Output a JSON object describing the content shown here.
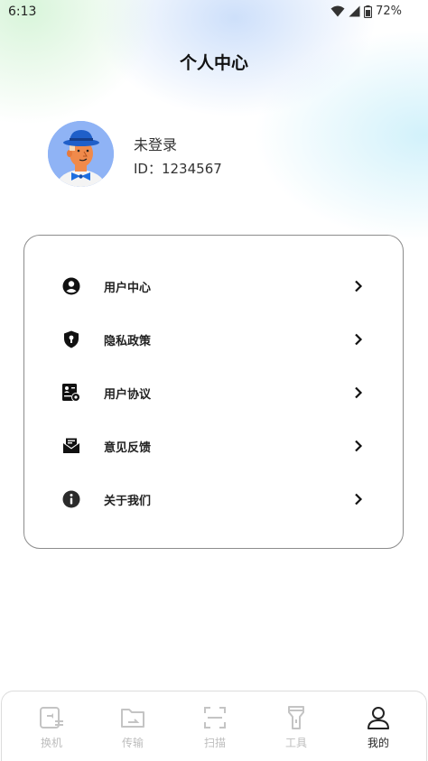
{
  "status_bar": {
    "time": "6:13",
    "battery": "72%",
    "icons": [
      "wifi-icon",
      "signal-icon",
      "battery-icon"
    ]
  },
  "header": {
    "title": "个人中心"
  },
  "profile": {
    "name": "未登录",
    "id_text": "ID：1234567",
    "avatar_colors": {
      "background": "#8fb3f5",
      "hat": "#1f5fc9",
      "bowtie": "#1e6fe0",
      "face": "#f08a4b"
    }
  },
  "menu": {
    "items": [
      {
        "label": "用户中心",
        "icon": "user-circle-icon"
      },
      {
        "label": "隐私政策",
        "icon": "shield-icon"
      },
      {
        "label": "用户协议",
        "icon": "agreement-icon"
      },
      {
        "label": "意见反馈",
        "icon": "feedback-mail-icon"
      },
      {
        "label": "关于我们",
        "icon": "info-icon"
      }
    ]
  },
  "bottom_nav": {
    "tabs": [
      {
        "label": "换机",
        "icon": "phone-swap-icon",
        "active": false
      },
      {
        "label": "传输",
        "icon": "folder-transfer-icon",
        "active": false
      },
      {
        "label": "扫描",
        "icon": "scan-icon",
        "active": false
      },
      {
        "label": "工具",
        "icon": "flashlight-icon",
        "active": false
      },
      {
        "label": "我的",
        "icon": "profile-icon",
        "active": true
      }
    ],
    "colors": {
      "active": "#222222",
      "inactive": "#bdbdbd"
    }
  }
}
